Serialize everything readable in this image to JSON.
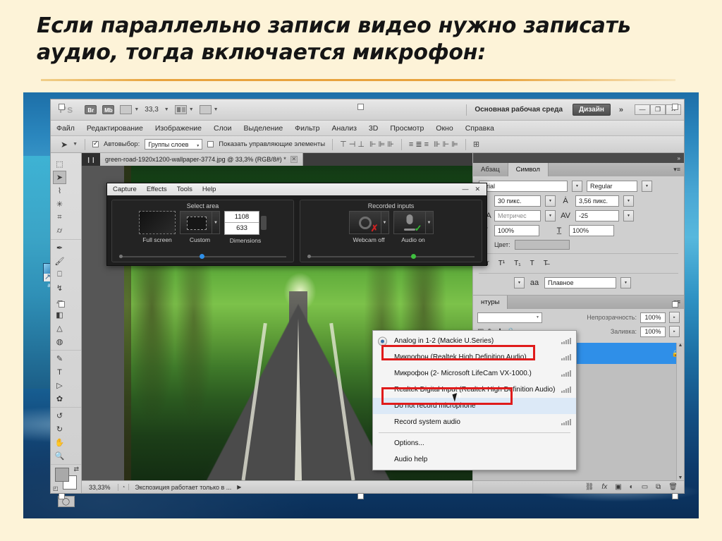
{
  "slide": {
    "title": "Если параллельно записи видео нужно записать аудио, тогда включается микрофон:"
  },
  "desktop": {
    "icon_label": "amt"
  },
  "photoshop": {
    "app_logo": "Ps",
    "appbar": {
      "bridge_button": "Br",
      "minibridge_button": "Mb",
      "zoom_value": "33,3",
      "workspace_label": "Основная рабочая среда",
      "workspace_active": "Дизайн",
      "workspace_more": "»",
      "minimize": "—",
      "restore": "❐",
      "close": "✕"
    },
    "menubar": [
      "Файл",
      "Редактирование",
      "Изображение",
      "Слои",
      "Выделение",
      "Фильтр",
      "Анализ",
      "3D",
      "Просмотр",
      "Окно",
      "Справка"
    ],
    "optionsbar": {
      "tool_icon": "move-tool",
      "autoselect_label": "Автовыбор:",
      "autoselect_value": "Группы слоев",
      "show_controls_label": "Показать управляющие элементы"
    },
    "document_tab": {
      "title": "green-road-1920x1200-wallpaper-3774.jpg @ 33,3%  (RGB/8#) *",
      "close": "✕"
    },
    "status_bar": {
      "zoom": "33,33%",
      "message": "Экспозиция работает только в ...",
      "arrow": "▶"
    },
    "character_panel": {
      "tabs": [
        "Абзац",
        "Символ"
      ],
      "active_tab": "Символ",
      "font_family": "Arial",
      "font_style": "Regular",
      "font_size": "30 пикс.",
      "leading": "3,56 пикс.",
      "kerning": "Метричес",
      "tracking": "-25",
      "vertical_scale": "100%",
      "horizontal_scale": "100%",
      "color_label": "Цвет:",
      "color_value": "#bdbdbd",
      "style_buttons": [
        "Tт",
        "T¹",
        "T₁",
        "T",
        "T̶"
      ],
      "antialias_label": "aa",
      "antialias_value": "Плавное"
    },
    "layers_panel": {
      "tab": "нтуры",
      "blend_mode": "",
      "opacity_label": "Непрозрачность:",
      "opacity_value": "100%",
      "fill_label": "Заливка:",
      "fill_value": "100%",
      "layer_locked_icon": "lock-icon",
      "footer_icons": [
        "link-icon",
        "fx-icon",
        "mask-icon",
        "adjustment-icon",
        "group-icon",
        "new-layer-icon",
        "delete-icon"
      ]
    }
  },
  "recorder": {
    "menubar": [
      "Capture",
      "Effects",
      "Tools",
      "Help"
    ],
    "window_controls": {
      "minimize": "—",
      "close": "✕"
    },
    "select_area": {
      "title": "Select area",
      "fullscreen_label": "Full screen",
      "custom_label": "Custom",
      "dimensions_label": "Dimensions",
      "width": "1108",
      "height": "633"
    },
    "recorded_inputs": {
      "title": "Recorded inputs",
      "webcam_label": "Webcam off",
      "audio_label": "Audio on"
    }
  },
  "audio_menu": {
    "items": [
      {
        "label": "Analog in 1-2 (Mackie U.Series)",
        "selected": true,
        "bars": true,
        "highlighted": false,
        "boxed": false
      },
      {
        "label": "Микрофон (Realtek High Definition Audio)",
        "selected": false,
        "bars": true,
        "highlighted": false,
        "boxed": true
      },
      {
        "label": "Микрофон (2- Microsoft LifeCam VX-1000.)",
        "selected": false,
        "bars": true,
        "highlighted": false,
        "boxed": false
      },
      {
        "label": "Realtek Digital Input (Realtek High Definition Audio)",
        "selected": false,
        "bars": true,
        "highlighted": false,
        "boxed": false
      },
      {
        "label": "Do not record microphone",
        "selected": false,
        "bars": false,
        "highlighted": true,
        "boxed": true
      },
      {
        "label": "Record system audio",
        "selected": false,
        "bars": true,
        "highlighted": false,
        "boxed": false
      },
      {
        "label": "Options...",
        "selected": false,
        "bars": false,
        "highlighted": false,
        "boxed": false
      },
      {
        "label": "Audio help",
        "selected": false,
        "bars": false,
        "highlighted": false,
        "boxed": false
      }
    ],
    "highlight_color": "#e01b1b"
  }
}
